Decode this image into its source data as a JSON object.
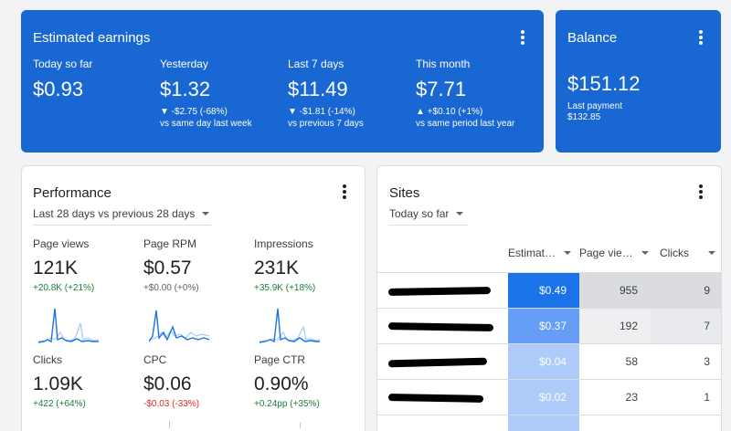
{
  "earnings": {
    "title": "Estimated earnings",
    "metrics": [
      {
        "label": "Today so far",
        "value": "$0.93",
        "change": "",
        "compare": ""
      },
      {
        "label": "Yesterday",
        "value": "$1.32",
        "change": "▼ -$2.75 (-68%)",
        "compare": "vs same day last week"
      },
      {
        "label": "Last 7 days",
        "value": "$11.49",
        "change": "▼ -$1.81 (-14%)",
        "compare": "vs previous 7 days"
      },
      {
        "label": "This month",
        "value": "$7.71",
        "change": "▲ +$0.10 (+1%)",
        "compare": "vs same period last year"
      }
    ]
  },
  "balance": {
    "title": "Balance",
    "value": "$151.12",
    "last_payment_label": "Last payment",
    "last_payment_value": "$132.85"
  },
  "performance": {
    "title": "Performance",
    "range": "Last 28 days vs previous 28 days",
    "metrics": [
      {
        "label": "Page views",
        "value": "121K",
        "change": "+20.8K (+21%)",
        "trend": "positive"
      },
      {
        "label": "Page RPM",
        "value": "$0.57",
        "change": "+$0.00 (+0%)",
        "trend": "neutral"
      },
      {
        "label": "Impressions",
        "value": "231K",
        "change": "+35.9K (+18%)",
        "trend": "positive"
      },
      {
        "label": "Clicks",
        "value": "1.09K",
        "change": "+422 (+64%)",
        "trend": "positive"
      },
      {
        "label": "CPC",
        "value": "$0.06",
        "change": "-$0.03 (-33%)",
        "trend": "negative"
      },
      {
        "label": "Page CTR",
        "value": "0.90%",
        "change": "+0.24pp (+35%)",
        "trend": "positive"
      }
    ]
  },
  "sites": {
    "title": "Sites",
    "range": "Today so far",
    "columns": [
      "Estimat…",
      "Page vie…",
      "Clicks"
    ],
    "rows": [
      {
        "earnings": "$0.49",
        "page_views": "955",
        "clicks": "9"
      },
      {
        "earnings": "$0.37",
        "page_views": "192",
        "clicks": "7"
      },
      {
        "earnings": "$0.04",
        "page_views": "58",
        "clicks": "3"
      },
      {
        "earnings": "$0.02",
        "page_views": "23",
        "clicks": "1"
      }
    ]
  },
  "colors": {
    "primary_blue": "#1967d2",
    "positive": "#188038",
    "negative": "#d93025",
    "sparkline_current": "#1a73e8",
    "sparkline_previous": "#a8c7fa"
  },
  "icons": [
    "more-vert-icon",
    "dropdown-caret-icon",
    "sort-caret-icon"
  ]
}
